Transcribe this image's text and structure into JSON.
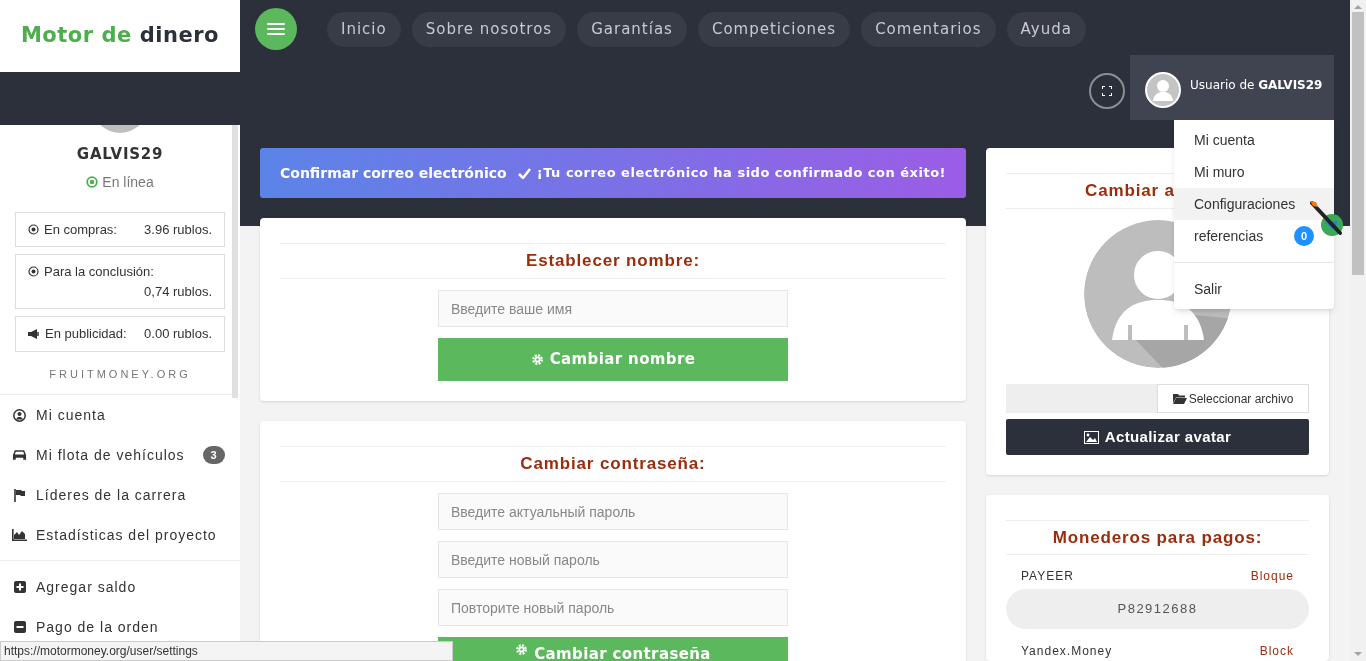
{
  "logo": {
    "accent": "Motor de",
    "rest": "dinero"
  },
  "nav": [
    "Inicio",
    "Sobre nosotros",
    "Garantías",
    "Competiciones",
    "Comentarios",
    "Ayuda"
  ],
  "user_box": {
    "label": "Usuario de **GALVIS29**"
  },
  "user_menu": {
    "items": [
      {
        "label": "Mi cuenta",
        "selected": false
      },
      {
        "label": "Mi muro",
        "selected": false
      },
      {
        "label": "Configuraciones",
        "selected": true
      },
      {
        "label": "referencias",
        "selected": false,
        "badge": "0"
      }
    ],
    "footer_items": [
      {
        "label": "Salir",
        "selected": false
      }
    ]
  },
  "profile": {
    "username": "GALVIS29",
    "status": "En línea"
  },
  "balances": [
    {
      "kind": "dot",
      "label": "En compras:",
      "value": "3.96 rublos."
    },
    {
      "kind": "dot",
      "label": "Para la conclusión:",
      "value": "0,74 rublos."
    },
    {
      "kind": "megaphone",
      "label": "En publicidad:",
      "value": "0.00 rublos."
    }
  ],
  "site_label": "FRUITMONEY.ORG",
  "sidebar_groups": [
    {
      "items": [
        {
          "kind": "account",
          "label": "Mi cuenta"
        },
        {
          "kind": "car",
          "label": "Mi flota de vehículos",
          "badge": "3"
        },
        {
          "kind": "flag",
          "label": "Líderes de la carrera"
        },
        {
          "kind": "chart",
          "label": "Estadísticas del proyecto"
        }
      ]
    },
    {
      "items": [
        {
          "kind": "plus",
          "label": "Agregar saldo"
        },
        {
          "kind": "minus",
          "label": "Pago de la orden"
        }
      ]
    }
  ],
  "email_banner": {
    "title": "Confirmar correo electrónico",
    "message": "¡Tu correo electrónico ha sido confirmado con éxito!"
  },
  "name_card": {
    "title": "Establecer nombre:",
    "fields": [
      {
        "placeholder": "Введите ваше имя"
      }
    ],
    "button": "Cambiar nombre"
  },
  "password_card": {
    "title": "Cambiar contraseña:",
    "fields": [
      {
        "placeholder": "Введите актуальный пароль"
      },
      {
        "placeholder": "Введите новый пароль"
      },
      {
        "placeholder": "Повторите новый пароль"
      }
    ],
    "button": "Cambiar contraseña"
  },
  "avatar_card": {
    "title": "Cambiar a",
    "file_button": "Seleccionar archivo",
    "button": "Actualizar avatar"
  },
  "wallets_card": {
    "title": "Monederos para pagos:",
    "wallets": [
      {
        "name": "PAYEER",
        "action": "Bloque",
        "value": "P82912688"
      },
      {
        "name": "Yandex.Money",
        "action": "Block"
      }
    ]
  },
  "status_url": "https://motormoney.org/user/settings"
}
